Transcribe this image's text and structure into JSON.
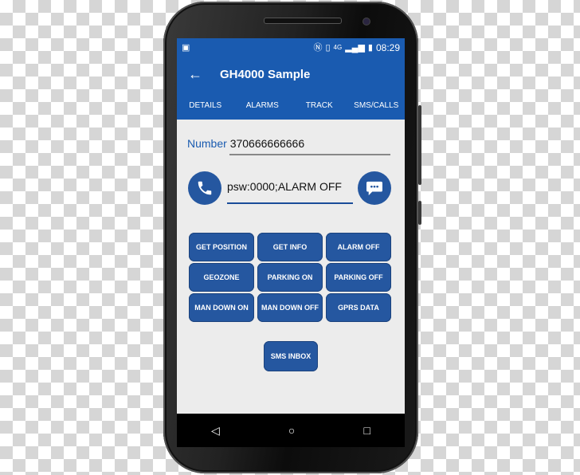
{
  "status_bar": {
    "left_icon": "image-notification-icon",
    "icons": [
      "nfc-icon",
      "vibrate-icon",
      "4g-icon",
      "signal-icon",
      "battery-icon"
    ],
    "time": "08:29"
  },
  "toolbar": {
    "back_icon": "arrow-left-icon",
    "title": "GH4000 Sample"
  },
  "tabs": [
    {
      "label": "DETAILS"
    },
    {
      "label": "ALARMS"
    },
    {
      "label": "TRACK"
    },
    {
      "label": "SMS/CALLS"
    }
  ],
  "number": {
    "label": "Number",
    "value": "370666666666"
  },
  "message": {
    "value": "psw:0000;ALARM OFF",
    "call_icon": "phone-icon",
    "send_icon": "chat-bubble-icon"
  },
  "command_buttons": [
    {
      "label": "GET POSITION"
    },
    {
      "label": "GET INFO"
    },
    {
      "label": "ALARM OFF"
    },
    {
      "label": "GEOZONE"
    },
    {
      "label": "PARKING ON"
    },
    {
      "label": "PARKING OFF"
    },
    {
      "label": "MAN DOWN ON"
    },
    {
      "label": "MAN DOWN OFF"
    },
    {
      "label": "GPRS DATA"
    }
  ],
  "sms_inbox": {
    "label": "SMS INBOX"
  },
  "navbar": {
    "back": "◁",
    "home": "○",
    "recents": "□"
  },
  "colors": {
    "primary": "#1a5bb0",
    "button": "#2557a0",
    "background": "#ececec"
  }
}
